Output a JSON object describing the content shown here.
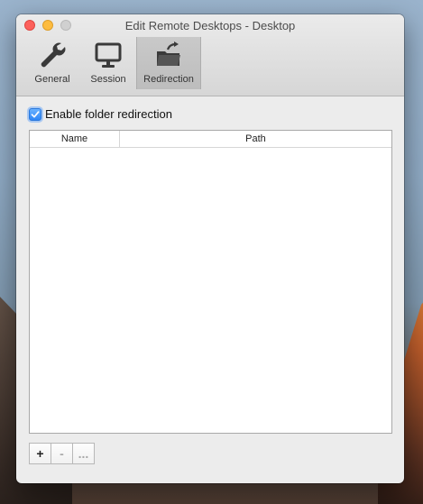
{
  "window": {
    "title": "Edit Remote Desktops - Desktop"
  },
  "toolbar": {
    "items": [
      {
        "label": "General",
        "icon": "wrench-icon"
      },
      {
        "label": "Session",
        "icon": "monitor-icon"
      },
      {
        "label": "Redirection",
        "icon": "folder-redirect-icon",
        "selected": true
      }
    ]
  },
  "redirection": {
    "enable_label": "Enable folder redirection",
    "enabled": true
  },
  "table": {
    "columns": [
      "Name",
      "Path"
    ],
    "rows": []
  },
  "buttons": {
    "add": "+",
    "remove": "-",
    "more": "..."
  },
  "colors": {
    "accent": "#2d86f7"
  }
}
